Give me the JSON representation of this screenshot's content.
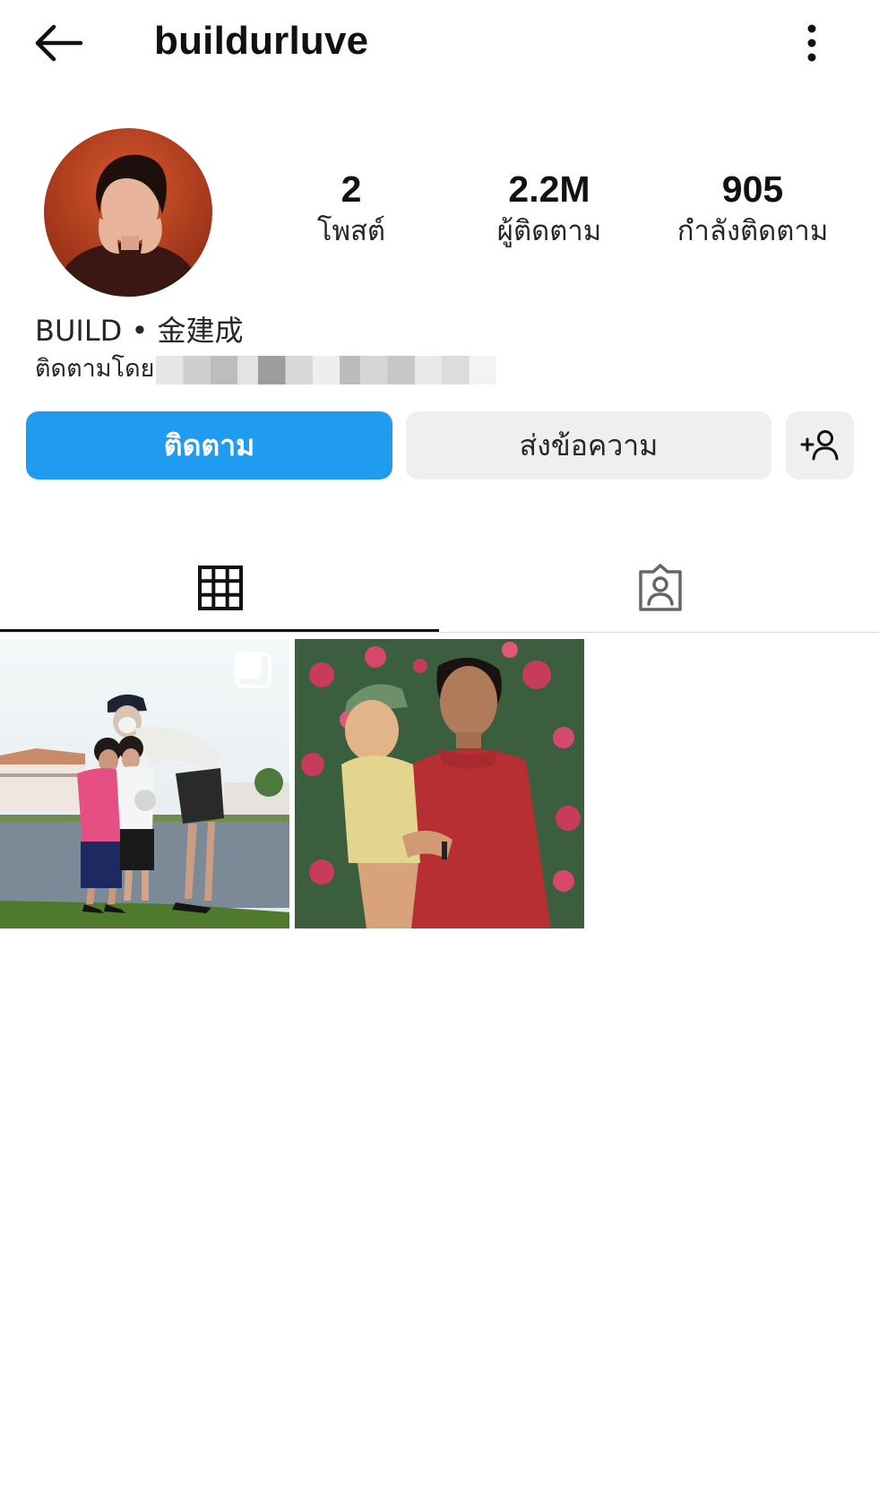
{
  "header": {
    "username": "buildurluve",
    "back_icon": "arrow-left-icon",
    "more_icon": "more-vertical-icon"
  },
  "profile": {
    "display_name": "BUILD • 金建成",
    "followed_by_prefix": "ติดตามโดย",
    "stats": {
      "posts": {
        "value": "2",
        "label": "โพสต์"
      },
      "followers": {
        "value": "2.2M",
        "label": "ผู้ติดตาม"
      },
      "following": {
        "value": "905",
        "label": "กำลังติดตาม"
      }
    }
  },
  "actions": {
    "follow_label": "ติดตาม",
    "message_label": "ส่งข้อความ",
    "add_user_icon": "add-person-icon"
  },
  "tabs": [
    {
      "name": "grid",
      "icon": "grid-icon",
      "active": true
    },
    {
      "name": "tagged",
      "icon": "tagged-person-icon",
      "active": false
    }
  ],
  "posts": [
    {
      "type": "multi-photo",
      "badge_icon": "carousel-icon"
    },
    {
      "type": "photo"
    }
  ],
  "colors": {
    "accent": "#1f9bf0",
    "secondary_button": "#efefef",
    "text": "#111111"
  }
}
